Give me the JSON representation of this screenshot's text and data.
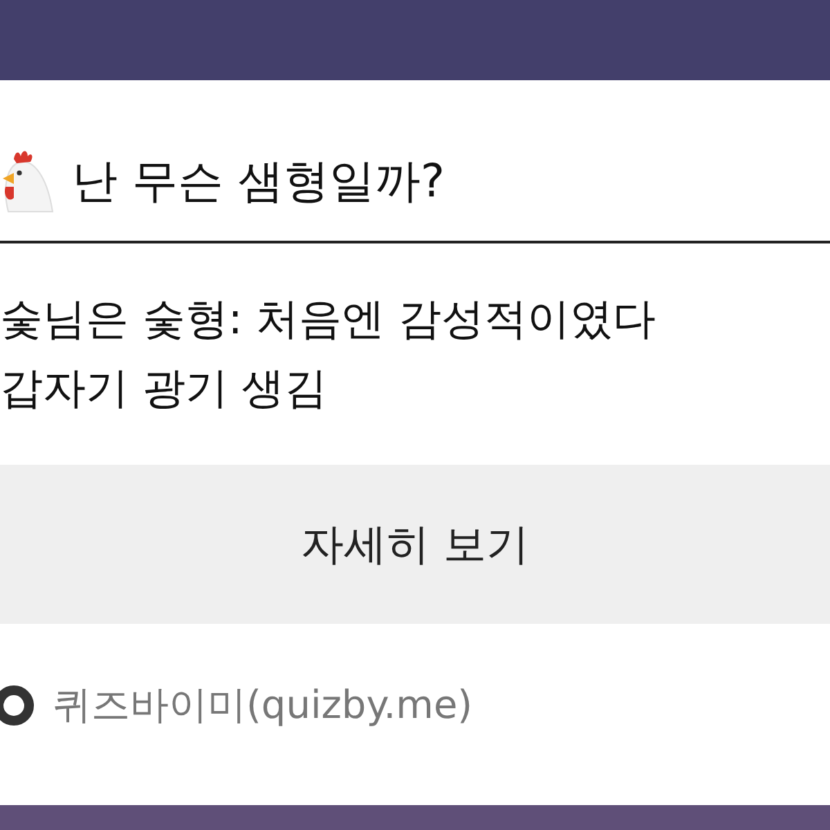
{
  "title": "난 무슨 샘형일까?",
  "result_lines": [
    "숯님은 숯형: 처음엔 감성적이였다",
    "갑자기 광기 생김"
  ],
  "detail_button": "자세히 보기",
  "source": "퀴즈바이미(quizby.me)"
}
